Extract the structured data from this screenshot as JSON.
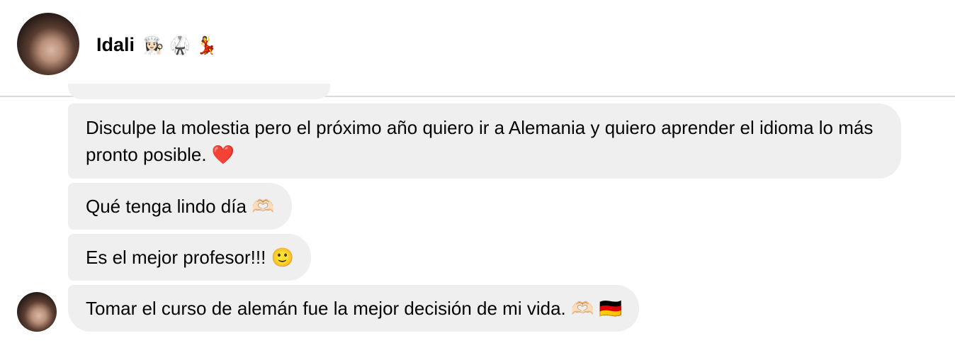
{
  "header": {
    "name": "Idali",
    "name_emojis": "👩🏻‍🍳 🥋 💃"
  },
  "messages": [
    {
      "text": "Disculpe la molestia pero el próximo año quiero ir a Alemania y quiero aprender el idioma lo más pronto posible. ❤️"
    },
    {
      "text": "Qué tenga lindo día 🫶🏻"
    },
    {
      "text": "Es el mejor profesor!!! 🙂"
    },
    {
      "text": "Tomar el curso de alemán fue la mejor decisión de mi vida. 🫶🏻 🇩🇪"
    }
  ],
  "colors": {
    "bubble": "#efefef",
    "text": "#050505",
    "divider": "#dcdcdc"
  }
}
